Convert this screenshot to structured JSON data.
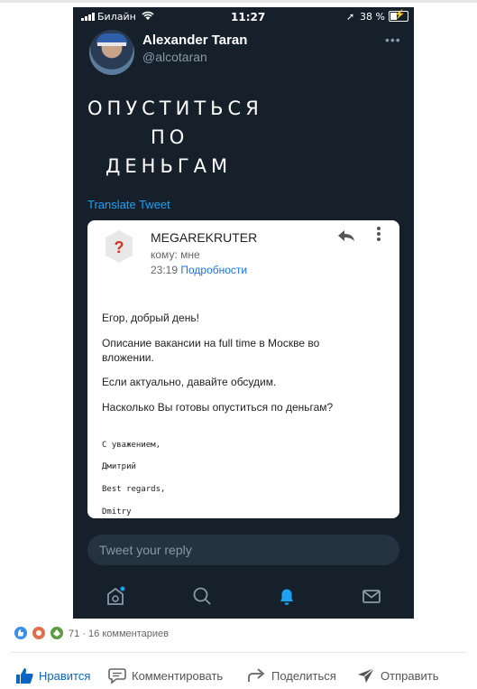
{
  "status_bar": {
    "carrier": "Билайн",
    "time": "11:27",
    "battery": "38 %"
  },
  "tweet": {
    "author_name": "Alexander Taran",
    "author_handle": "@alcotaran",
    "more": "•••",
    "text_lines": [
      "ОПУСТИТЬСЯ",
      "ПО",
      "ДЕНЬГАМ"
    ],
    "translate": "Translate Tweet"
  },
  "email": {
    "sender": "MEGAREKRUTER",
    "to": "кому: мне",
    "time": "23:19",
    "details": "Подробности",
    "paragraphs": [
      "Егор, добрый день!",
      "Описание вакансии на full time в Москве во вложении.",
      "Если актуально, давайте обсудим.",
      "Насколько Вы готовы опуститься по деньгам?"
    ],
    "signature": [
      "С уважением,",
      "Дмитрий",
      "Best regards,",
      "Dmitry"
    ]
  },
  "reply_placeholder": "Tweet your reply",
  "tabs": [
    "home-icon",
    "search-icon",
    "notifications-icon",
    "messages-icon"
  ],
  "post_footer": {
    "reactions_count": "71",
    "separator": "·",
    "comments": "16 комментариев",
    "actions": {
      "like": "Нравится",
      "comment": "Комментировать",
      "share": "Поделиться",
      "send": "Отправить"
    }
  },
  "colors": {
    "phone_bg": "#15202b",
    "accent": "#1da1f2",
    "like": "#0a66c2"
  }
}
